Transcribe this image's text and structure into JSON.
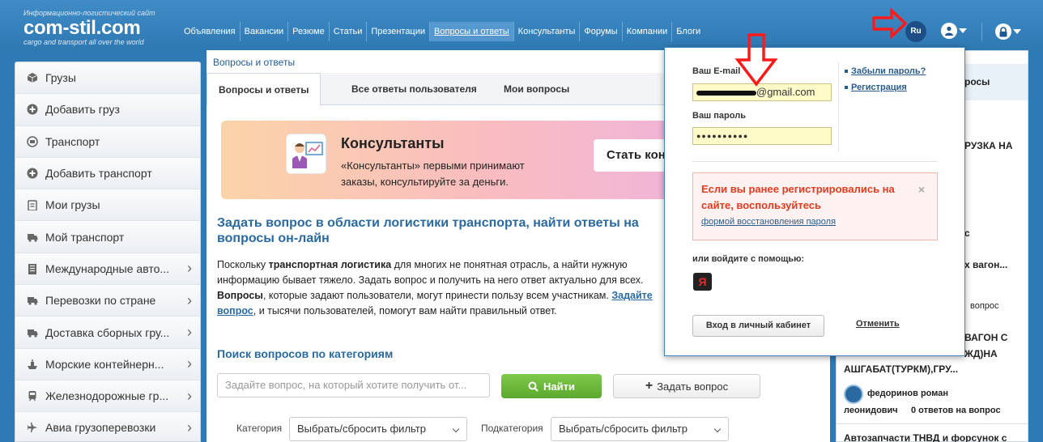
{
  "header": {
    "logo_top": "Информационно-логистический сайт",
    "logo_main": "com-stil.com",
    "logo_bottom": "cargo and transport all over the world",
    "nav": [
      "Объявления",
      "Вакансии",
      "Резюме",
      "Статьи",
      "Презентации",
      "Вопросы и ответы",
      "Консультанты",
      "Форумы",
      "Компании",
      "Блоги"
    ],
    "nav_active_index": 5,
    "lang": "Ru",
    "user_icon": "user-icon",
    "lock_icon": "lock-icon"
  },
  "sidebar": {
    "items": [
      {
        "label": "Грузы",
        "icon": "box-icon",
        "chevron": false
      },
      {
        "label": "Добавить груз",
        "icon": "plus-circle-icon",
        "chevron": false
      },
      {
        "label": "Транспорт",
        "icon": "transport-icon",
        "chevron": false
      },
      {
        "label": "Добавить транспорт",
        "icon": "plus-circle-icon",
        "chevron": false
      },
      {
        "label": "Мои грузы",
        "icon": "clipboard-icon",
        "chevron": false
      },
      {
        "label": "Мой транспорт",
        "icon": "truck-icon",
        "chevron": false
      },
      {
        "label": "Международные авто...",
        "icon": "building-icon",
        "chevron": true
      },
      {
        "label": "Перевозки по стране",
        "icon": "truck-icon",
        "chevron": true
      },
      {
        "label": "Доставка сборных гру...",
        "icon": "truck-icon",
        "chevron": true
      },
      {
        "label": "Морские контейнерн...",
        "icon": "ship-icon",
        "chevron": true
      },
      {
        "label": "Железнодорожные гр...",
        "icon": "train-icon",
        "chevron": true
      },
      {
        "label": "Авиа грузоперевозки",
        "icon": "plane-icon",
        "chevron": true
      }
    ]
  },
  "main": {
    "breadcrumb": "Вопросы и ответы",
    "tabs": [
      "Вопросы и ответы",
      "Все ответы пользователя",
      "Мои вопросы"
    ],
    "banner": {
      "title": "Консультанты",
      "text": "«Консультанты» первыми принимают заказы, консультируйте за деньги.",
      "button": "Стать консультантом"
    },
    "heading": "Задать вопрос в области логистики транспорта, найти ответы на вопросы он-лайн",
    "para": {
      "p1": "Поскольку ",
      "b1": "транспортная логистика",
      "p2": " для многих не понятная отрасль, а найти нужную информацию бывает тяжело. Задать вопрос и получить на него ответ актуально для всех. ",
      "b2": "Вопросы",
      "p3": ", которые задают пользователи, могут принести пользу всем участникам. ",
      "link": "Задайте вопрос",
      "p4": ", и тысячи пользователей, помогут вам найти правильный ответ."
    },
    "search_heading": "Поиск вопросов по категориям",
    "search_placeholder": "Задайте вопрос, на который хотите получить от...",
    "find_button": "Найти",
    "ask_button": "Задать вопрос",
    "category_label": "Категория",
    "category_value": "Выбрать/сбросить фильтр",
    "subcategory_label": "Подкатегория",
    "subcategory_value": "Выбрать/сбросить фильтр"
  },
  "right_panel": {
    "items": [
      "росы",
      "РУЗКА НА",
      "с",
      "х вагон...",
      "вопрос",
      "ВАГОН С",
      "ЖД)НА",
      "АШГАБАТ(ТУРКМ),ГРУ...",
      "федоринов роман",
      "леонидович",
      "0 ответов на вопрос",
      "Автозапчасти ТНВД и форсунок с"
    ]
  },
  "login_popup": {
    "email_label": "Ваш E-mail",
    "email_value": "@gmail.com",
    "password_label": "Ваш пароль",
    "password_value": "●●●●●●●●●●",
    "forgot_link": "Забыли пароль?",
    "register_link": "Регистрация",
    "warning_text": "Если вы ранее регистрировались на сайте, воспользуйтесь",
    "warning_link": "формой восстановления пароля",
    "social_label": "или войдите с помощью:",
    "yandex": "Я",
    "login_button": "Вход в личный кабинет",
    "cancel_link": "Отменить"
  },
  "colors": {
    "header": "#3a86c1",
    "accent": "#2a6aa0",
    "warning": "#e23b20",
    "green": "#5aa82e",
    "arrow": "#ff1a1a"
  }
}
